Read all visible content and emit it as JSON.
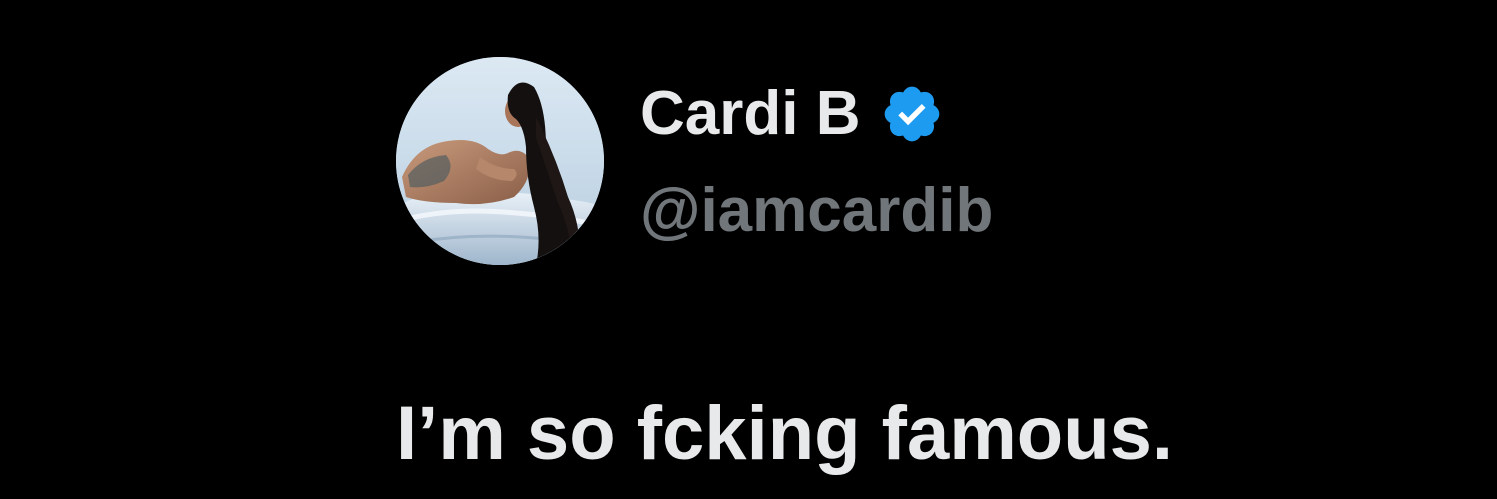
{
  "tweet": {
    "author": {
      "display_name": "Cardi B",
      "handle": "@iamcardib",
      "verified": true,
      "verified_icon": "verified-badge-icon",
      "avatar_icon": "profile-photo"
    },
    "text": "I’m so fcking famous."
  },
  "colors": {
    "background": "#000000",
    "primary_text": "#e7e9ea",
    "secondary_text": "#71767b",
    "verified_blue": "#1d9bf0"
  }
}
